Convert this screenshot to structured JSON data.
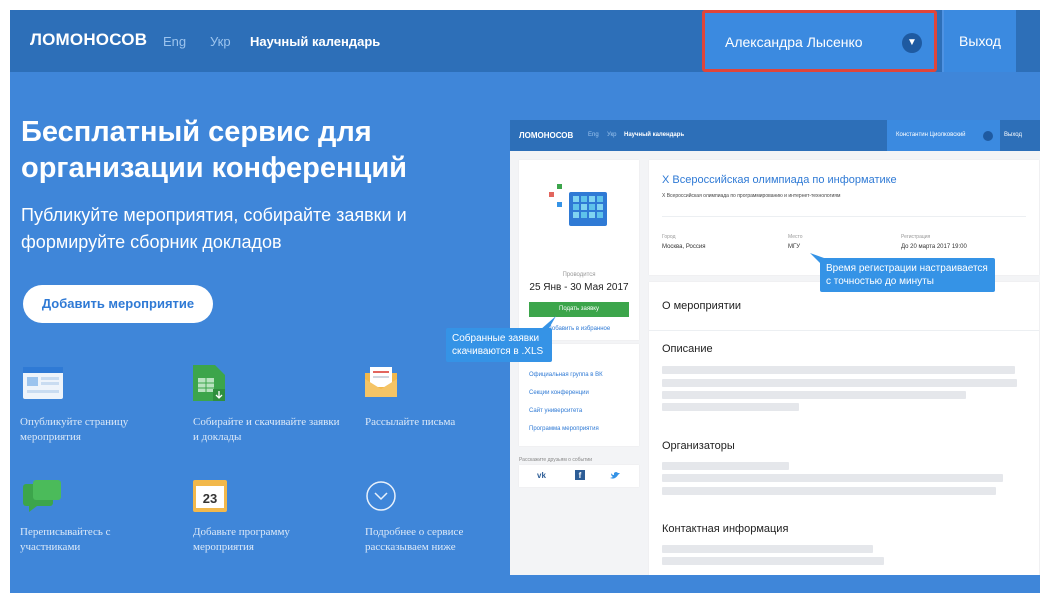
{
  "header": {
    "logo": "ЛОМОНОСОВ",
    "lang_eng": "Eng",
    "lang_ukr": "Укр",
    "calendar_link": "Научный календарь",
    "user_name": "Александра Лысенко",
    "logout_label": "Выход"
  },
  "hero": {
    "title": "Бесплатный сервис для организации конференций",
    "subtitle": "Публикуйте мероприятия, собирайте заявки и формируйте сборник докладов",
    "add_event_button": "Добавить мероприятие"
  },
  "features": [
    {
      "label": "Опубликуйте страницу мероприятия",
      "icon": "page-icon"
    },
    {
      "label": "Собирайте и скачивайте заявки и доклады",
      "icon": "spreadsheet-download-icon"
    },
    {
      "label": "Рассылайте письма",
      "icon": "envelope-icon"
    },
    {
      "label": "Переписывайтесь с участниками",
      "icon": "chat-icon"
    },
    {
      "label": "Добавьте программу мероприятия",
      "icon": "calendar-icon",
      "calendar_day": "23"
    },
    {
      "label": "Подробнее о сервисе рассказываем ниже",
      "icon": "chevron-circle-icon"
    }
  ],
  "preview": {
    "logo": "ЛОМОНОСОВ",
    "lang_eng": "Eng",
    "lang_ukr": "Укр",
    "calendar_link": "Научный календарь",
    "user_name": "Константин Циолковский",
    "logout_label": "Выход",
    "event_title": "X Всероссийская олимпиада по информатике",
    "event_subtitle": "X Всероссийская олимпиада по программированию и интернет-технологиям",
    "city_label": "Город",
    "city_value": "Москва, Россия",
    "place_label": "Место",
    "place_value": "МГУ",
    "registration_label": "Регистрация",
    "registration_value": "До 20 марта 2017 19:00",
    "held_label": "Проводится",
    "dates": "25 Янв - 30 Мая 2017",
    "apply_button": "Подать заявку",
    "favorite_link": "Добавить в избранное",
    "links": [
      "Официальная группа в ВК",
      "Секции конференции",
      "Сайт университета",
      "Программа мероприятия"
    ],
    "share_label": "Расскажите друзьям о событии",
    "about_heading": "О мероприятии",
    "description_heading": "Описание",
    "organizers_heading": "Организаторы",
    "contacts_heading": "Контактная информация"
  },
  "tooltips": {
    "registration": "Время регистрации настраивается с точностью до минуты",
    "applications": "Собранные заявки скачиваются в .XLS"
  },
  "colors": {
    "background": "#3f86d9",
    "topbar": "#2d6fb8",
    "highlight_border": "#e0453a",
    "apply_button": "#3ca54b",
    "tooltip": "#3593e6"
  }
}
